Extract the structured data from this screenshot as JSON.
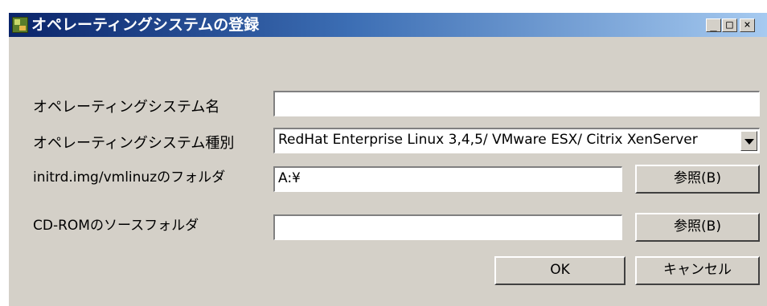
{
  "window": {
    "title": "オペレーティングシステムの登録",
    "minimize": "_",
    "maximize": "□",
    "close": "×"
  },
  "form": {
    "os_name": {
      "label": "オペレーティングシステム名",
      "value": ""
    },
    "os_type": {
      "label": "オペレーティングシステム種別",
      "value": "RedHat Enterprise Linux 3,4,5/ VMware ESX/ Citrix XenServer"
    },
    "initrd_folder": {
      "label": "initrd.img/vmlinuzのフォルダ",
      "value": "A:¥",
      "browse": "参照(B)"
    },
    "cdrom_folder": {
      "label": "CD-ROMのソースフォルダ",
      "value": "",
      "browse": "参照(B)"
    }
  },
  "actions": {
    "ok": "OK",
    "cancel": "キャンセル"
  }
}
